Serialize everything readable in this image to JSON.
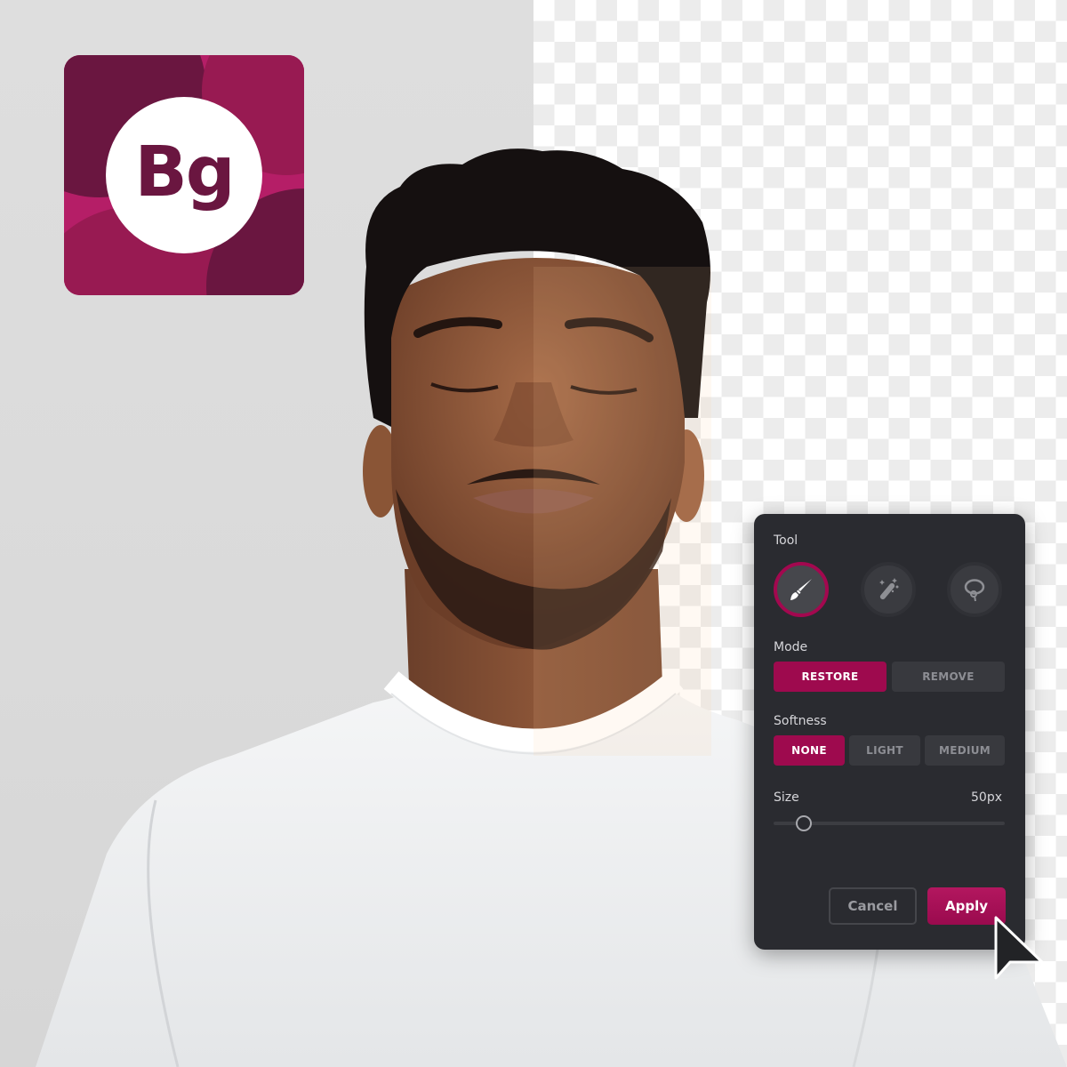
{
  "logo": {
    "text": "Bg",
    "icon": "bg-app-logo-icon",
    "colors": {
      "primary": "#b51e67",
      "dark": "#6a1640",
      "mid": "#981a52",
      "circle": "#ffffff"
    }
  },
  "canvas": {
    "left_background": "original-gray-background",
    "right_background": "transparency-checkerboard",
    "subject": "man-with-closed-eyes-white-tshirt"
  },
  "panel": {
    "tool": {
      "label": "Tool",
      "items": [
        {
          "name": "brush",
          "icon": "paintbrush-icon",
          "active": true
        },
        {
          "name": "magic-wand",
          "icon": "magic-wand-icon",
          "active": false
        },
        {
          "name": "lasso",
          "icon": "lasso-icon",
          "active": false
        }
      ]
    },
    "mode": {
      "label": "Mode",
      "options": [
        {
          "label": "RESTORE",
          "active": true
        },
        {
          "label": "REMOVE",
          "active": false
        }
      ]
    },
    "softness": {
      "label": "Softness",
      "options": [
        {
          "label": "NONE",
          "active": true
        },
        {
          "label": "LIGHT",
          "active": false
        },
        {
          "label": "MEDIUM",
          "active": false
        }
      ]
    },
    "size": {
      "label": "Size",
      "value_text": "50px",
      "value": 50,
      "slider_fraction": 0.13
    },
    "buttons": {
      "cancel": "Cancel",
      "apply": "Apply"
    },
    "colors": {
      "accent": "#9e0a4e",
      "panel_bg": "#2a2b30",
      "segment_bg": "#38393e"
    }
  },
  "cursor": {
    "icon": "mouse-pointer-icon"
  }
}
